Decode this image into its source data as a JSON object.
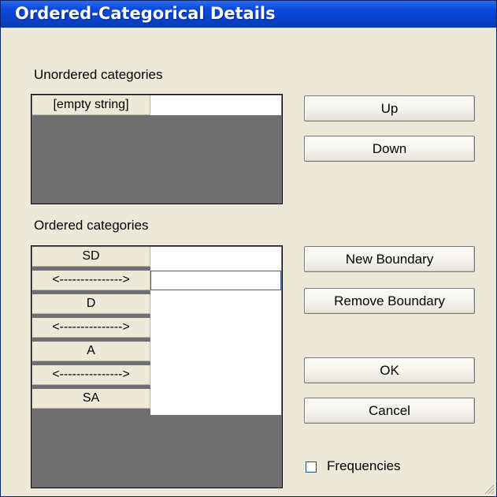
{
  "window": {
    "title": "Ordered-Categorical Details"
  },
  "unordered": {
    "label": "Unordered categories",
    "rows": [
      "[empty string]"
    ]
  },
  "ordered": {
    "label": "Ordered categories",
    "rows": [
      "SD",
      "<--------------->",
      "D",
      "<--------------->",
      "A",
      "<--------------->",
      "SA"
    ]
  },
  "buttons": {
    "up": "Up",
    "down": "Down",
    "new_boundary": "New Boundary",
    "remove_boundary": "Remove Boundary",
    "ok": "OK",
    "cancel": "Cancel"
  },
  "frequencies": {
    "label": "Frequencies",
    "checked": false
  },
  "colors": {
    "titlebar": "#0a4ae0",
    "dialog_bg": "#ece9d8",
    "grid_empty": "#6f6f6f"
  }
}
